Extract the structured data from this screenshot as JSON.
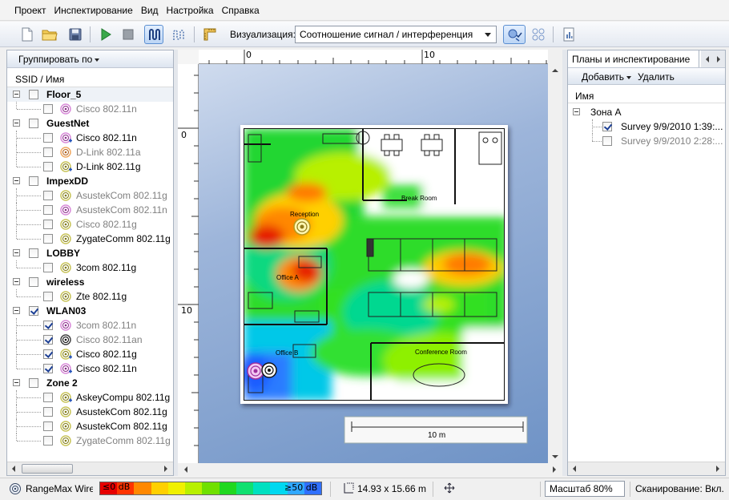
{
  "menu": [
    "Проект",
    "Инспектирование",
    "Вид",
    "Настройка",
    "Справка"
  ],
  "toolbar": {
    "viz_label": "Визуализация:",
    "viz_value": "Соотношение сигнал / интерференция"
  },
  "left": {
    "group_by": "Группировать по",
    "column": "SSID / Имя",
    "groups": [
      {
        "name": "Floor_5",
        "checked": false,
        "items": [
          {
            "name": "Cisco 802.11n",
            "checked": false,
            "gray": true,
            "icon": "router-purple-icon"
          }
        ]
      },
      {
        "name": "GuestNet",
        "checked": false,
        "items": [
          {
            "name": "Cisco 802.11n",
            "checked": false,
            "gray": false,
            "icon": "router-purple-plus-icon"
          },
          {
            "name": "D-Link 802.11a",
            "checked": false,
            "gray": true,
            "icon": "router-orange-icon"
          },
          {
            "name": "D-Link 802.11g",
            "checked": false,
            "gray": false,
            "icon": "router-yellow-plus-icon"
          }
        ]
      },
      {
        "name": "ImpexDD",
        "checked": false,
        "items": [
          {
            "name": "AsustekCom 802.11g",
            "checked": false,
            "gray": true,
            "icon": "router-yellow-icon"
          },
          {
            "name": "AsustekCom 802.11n",
            "checked": false,
            "gray": true,
            "icon": "router-purple-icon"
          },
          {
            "name": "Cisco 802.11g",
            "checked": false,
            "gray": true,
            "icon": "router-yellow-icon"
          },
          {
            "name": "ZygateComm 802.11g",
            "checked": false,
            "gray": false,
            "icon": "router-yellow-icon"
          }
        ]
      },
      {
        "name": "LOBBY",
        "checked": false,
        "items": [
          {
            "name": "3com 802.11g",
            "checked": false,
            "gray": false,
            "icon": "router-yellow-icon"
          }
        ]
      },
      {
        "name": "wireless",
        "checked": false,
        "items": [
          {
            "name": "Zte 802.11g",
            "checked": false,
            "gray": false,
            "icon": "router-yellow-icon"
          }
        ]
      },
      {
        "name": "WLAN03",
        "checked": true,
        "items": [
          {
            "name": "3com 802.11n",
            "checked": true,
            "gray": true,
            "icon": "router-purple-icon"
          },
          {
            "name": "Cisco 802.11an",
            "checked": true,
            "gray": true,
            "icon": "router-black-icon"
          },
          {
            "name": "Cisco 802.11g",
            "checked": true,
            "gray": false,
            "icon": "router-yellow-plus-icon"
          },
          {
            "name": "Cisco 802.11n",
            "checked": true,
            "gray": false,
            "icon": "router-purple-plus-icon"
          }
        ]
      },
      {
        "name": "Zone 2",
        "checked": false,
        "items": [
          {
            "name": "AskeyCompu 802.11g",
            "checked": false,
            "gray": false,
            "icon": "router-yellow-plus-icon"
          },
          {
            "name": "AsustekCom 802.11g",
            "checked": false,
            "gray": false,
            "icon": "router-yellow-icon"
          },
          {
            "name": "AsustekCom 802.11g",
            "checked": false,
            "gray": false,
            "icon": "router-yellow-icon"
          },
          {
            "name": "ZygateComm 802.11g",
            "checked": false,
            "gray": true,
            "icon": "router-yellow-icon"
          }
        ]
      }
    ]
  },
  "ruler": {
    "top": [
      "0",
      "10"
    ],
    "left": [
      "0",
      "10"
    ]
  },
  "map": {
    "rooms": [
      "Reception",
      "Office A",
      "Office B",
      "Break Room",
      "Conference Room"
    ],
    "scale_label": "10 m"
  },
  "right": {
    "tab": "Планы и инспектирование",
    "add": "Добавить",
    "delete": "Удалить",
    "column": "Имя",
    "zone": "Зона А",
    "surveys": [
      {
        "name": "Survey 9/9/2010 1:39:...",
        "checked": true
      },
      {
        "name": "Survey 9/9/2010 2:28:...",
        "checked": false
      }
    ]
  },
  "status": {
    "app": "RangeMax Wireless",
    "legend_low": "≤0 dB",
    "legend_high": "≥50 dB",
    "legend_colors": [
      "#e60000",
      "#ff3300",
      "#ff8800",
      "#ffd000",
      "#f0f000",
      "#b8f000",
      "#70e000",
      "#20d820",
      "#10e070",
      "#00e0c0",
      "#00d8f0",
      "#30a8ff",
      "#3070ff"
    ],
    "size": "14.93 x 15.66 m",
    "zoom": "Масштаб 80%",
    "scan": "Сканирование: Вкл."
  }
}
